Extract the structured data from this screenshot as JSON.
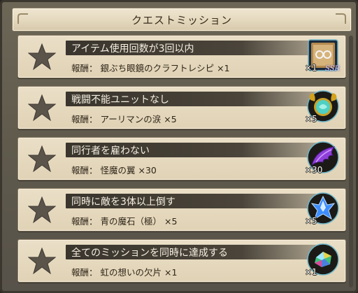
{
  "header": {
    "title": "クエストミッション"
  },
  "reward_label": "報酬：",
  "missions": [
    {
      "name": "アイテム使用回数が3回以内",
      "reward": "銀ぶち眼鏡のクラフトレシピ ×1",
      "qty": "×1",
      "rarity": "SSR",
      "icon": "recipe-book-icon",
      "completed": false
    },
    {
      "name": "戦闘不能ユニットなし",
      "reward": "アーリマンの涙 ×5",
      "qty": "×5",
      "rarity": "",
      "icon": "ahriman-tear-icon",
      "completed": false
    },
    {
      "name": "同行者を雇わない",
      "reward": "怪魔の翼 ×30",
      "qty": "×30",
      "rarity": "",
      "icon": "fiend-wing-icon",
      "completed": false
    },
    {
      "name": "同時に敵を3体以上倒す",
      "reward": "青の魔石（極） ×5",
      "qty": "×5",
      "rarity": "",
      "icon": "blue-magicite-icon",
      "completed": false
    },
    {
      "name": "全てのミッションを同時に達成する",
      "reward": "虹の想いの欠片 ×1",
      "qty": "×1",
      "rarity": "",
      "icon": "rainbow-shard-icon",
      "completed": false
    }
  ],
  "colors": {
    "panel": "#615c4f",
    "card": "#e6dabf",
    "namebar": "#3e392f",
    "star": "#55504a"
  }
}
